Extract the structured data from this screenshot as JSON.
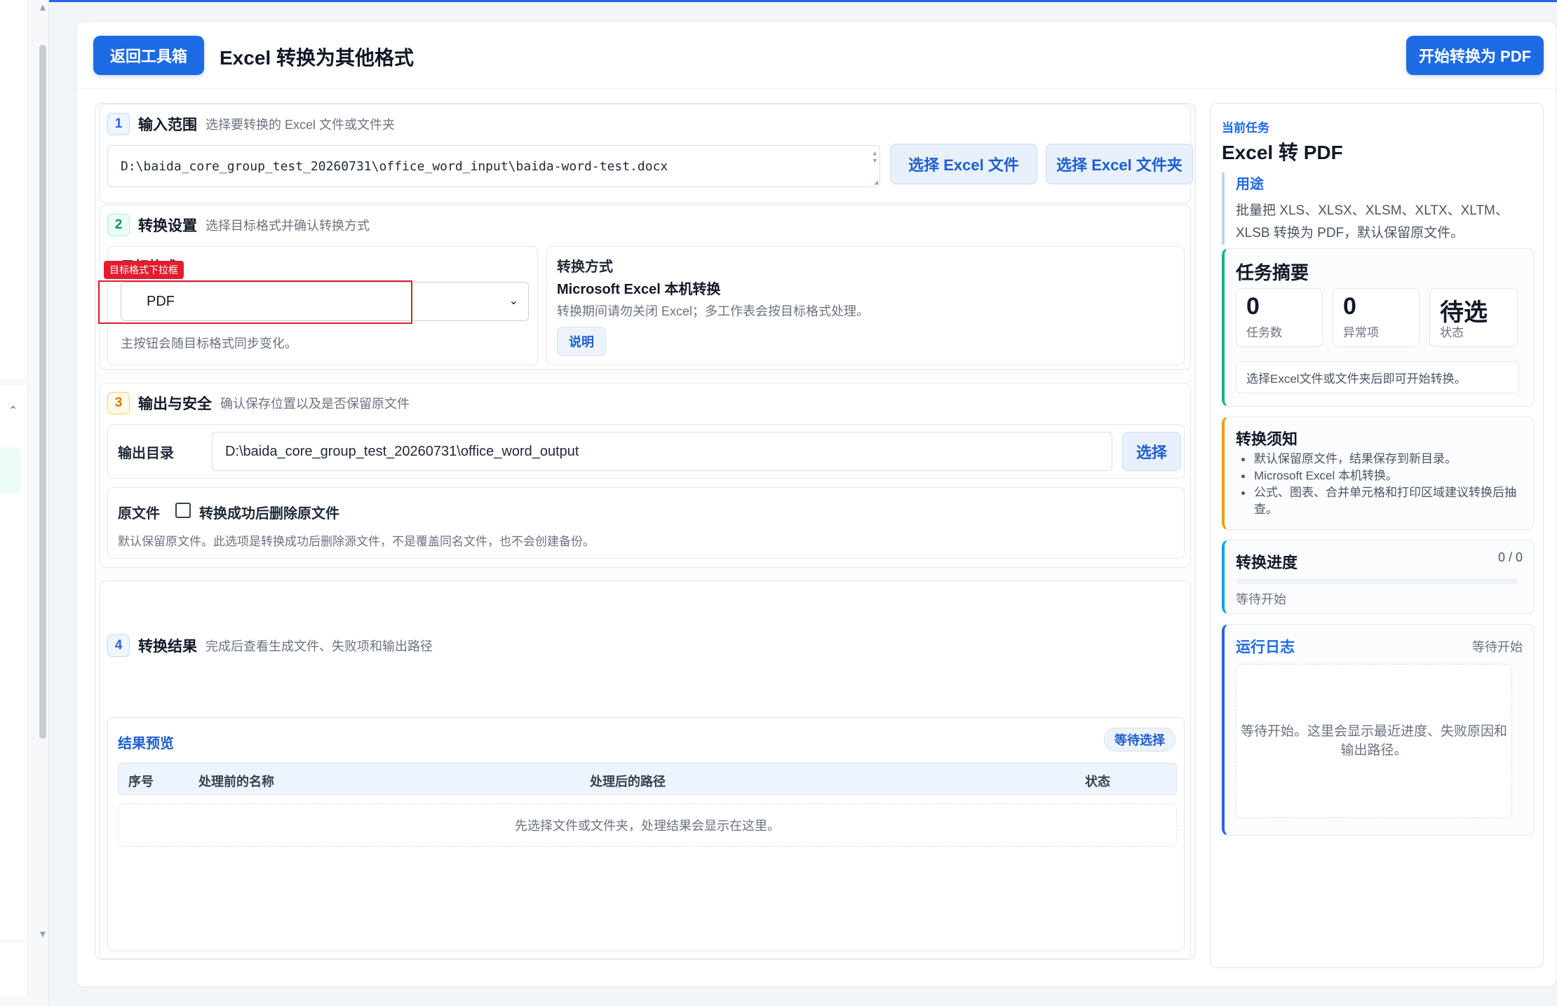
{
  "header": {
    "back_label": "返回工具箱",
    "title": "Excel 转换为其他格式",
    "start_label": "开始转换为 PDF"
  },
  "step1": {
    "number": "1",
    "title": "输入范围",
    "desc": "选择要转换的 Excel 文件或文件夹",
    "input_path": "D:\\baida_core_group_test_20260731\\office_word_input\\baida-word-test.docx",
    "select_file_label": "选择 Excel 文件",
    "select_folder_label": "选择 Excel 文件夹"
  },
  "step2": {
    "number": "2",
    "title": "转换设置",
    "desc": "选择目标格式并确认转换方式",
    "target_label": "目标格式",
    "annotation_tag": "目标格式下拉框",
    "target_value": "PDF",
    "target_hint": "主按钮会随目标格式同步变化。",
    "method_label": "转换方式",
    "method_name": "Microsoft Excel 本机转换",
    "method_note": "转换期间请勿关闭 Excel；多工作表会按目标格式处理。",
    "explain_label": "说明"
  },
  "step3": {
    "number": "3",
    "title": "输出与安全",
    "desc": "确认保存位置以及是否保留原文件",
    "output_label": "输出目录",
    "output_path": "D:\\baida_core_group_test_20260731\\office_word_output",
    "choose_label": "选择",
    "original_label": "原文件",
    "delete_label": "转换成功后删除原文件",
    "delete_checked": false,
    "delete_note": "默认保留原文件。此选项是转换成功后删除源文件，不是覆盖同名文件，也不会创建备份。"
  },
  "step4": {
    "number": "4",
    "title": "转换结果",
    "desc": "完成后查看生成文件、失败项和输出路径",
    "preview_label": "结果预览",
    "status_pill": "等待选择",
    "columns": [
      "序号",
      "处理前的名称",
      "处理后的路径",
      "状态"
    ],
    "empty_text": "先选择文件或文件夹，处理结果会显示在这里。"
  },
  "side": {
    "eyebrow": "当前任务",
    "title": "Excel 转 PDF",
    "purpose_label": "用途",
    "purpose_text": "批量把 XLS、XLSX、XLSM、XLTX、XLTM、XLSB 转换为 PDF，默认保留原文件。",
    "summary": {
      "title": "任务摘要",
      "stats": [
        {
          "value": "0",
          "label": "任务数"
        },
        {
          "value": "0",
          "label": "异常项"
        },
        {
          "value": "待选",
          "label": "状态"
        }
      ],
      "hint": "选择Excel文件或文件夹后即可开始转换。"
    },
    "notes": {
      "title": "转换须知",
      "items": [
        "默认保留原文件，结果保存到新目录。",
        "Microsoft Excel 本机转换。",
        "公式、图表、合并单元格和打印区域建议转换后抽查。"
      ]
    },
    "progress": {
      "title": "转换进度",
      "value_text": "0 / 0",
      "fraction": 0,
      "status": "等待开始"
    },
    "log": {
      "title": "运行日志",
      "status": "等待开始",
      "placeholder": "等待开始。这里会显示最近进度、失败原因和输出路径。"
    }
  },
  "colors": {
    "accent": "#1d6ae5",
    "annotation": "#e11d2e",
    "summary_border": "#10b981",
    "notes_border": "#f59e0b"
  }
}
